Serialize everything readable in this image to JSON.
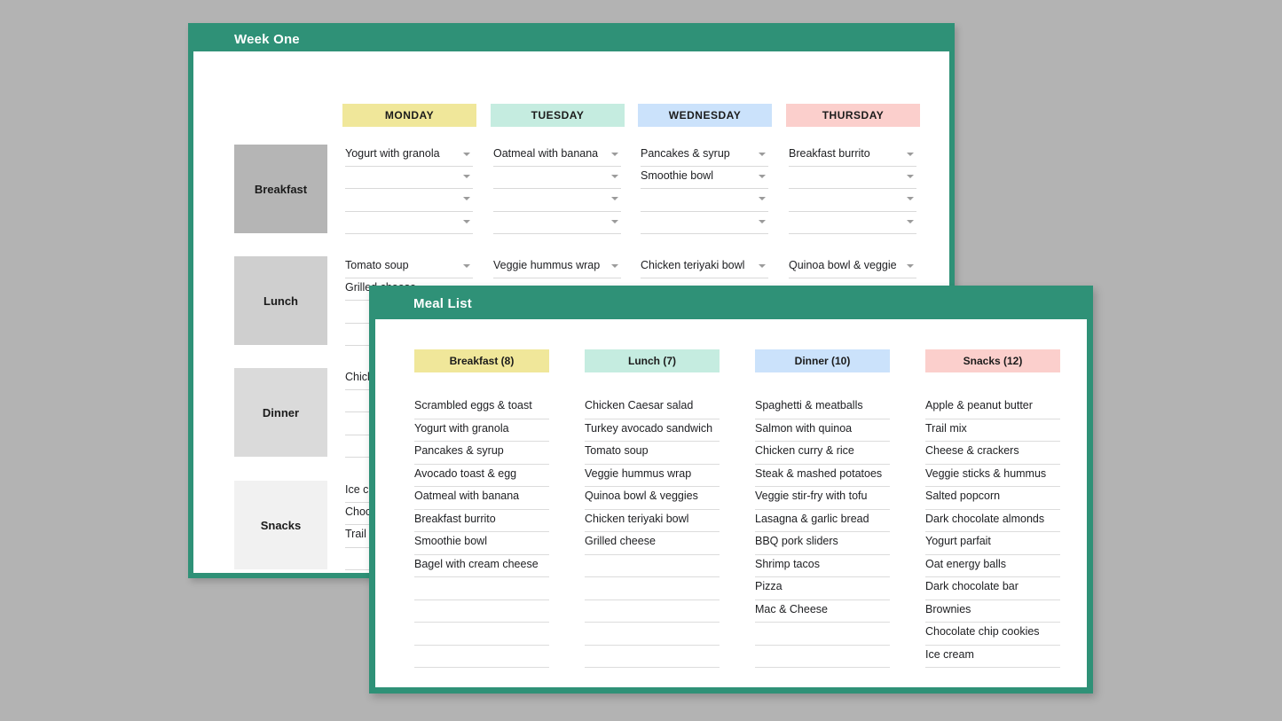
{
  "week_window": {
    "title": "Week One",
    "days": [
      {
        "label": "MONDAY",
        "color": "#f0e79a"
      },
      {
        "label": "TUESDAY",
        "color": "#c5ece0"
      },
      {
        "label": "WEDNESDAY",
        "color": "#cbe2fb"
      },
      {
        "label": "THURSDAY",
        "color": "#fbcfcc"
      }
    ],
    "meal_rows": [
      {
        "label": "Breakfast",
        "swatch": "#b5b5b5",
        "columns": [
          [
            "Yogurt with granola",
            "",
            "",
            ""
          ],
          [
            "Oatmeal with banana",
            "",
            "",
            ""
          ],
          [
            "Pancakes & syrup",
            "Smoothie bowl",
            "",
            ""
          ],
          [
            "Breakfast burrito",
            "",
            "",
            ""
          ]
        ]
      },
      {
        "label": "Lunch",
        "swatch": "#cfcfcf",
        "columns": [
          [
            "Tomato soup",
            "Grilled cheese",
            "",
            ""
          ],
          [
            "Veggie hummus wrap",
            "",
            "",
            ""
          ],
          [
            "Chicken teriyaki bowl",
            "",
            "",
            ""
          ],
          [
            "Quinoa bowl & veggies",
            "",
            "",
            ""
          ]
        ]
      },
      {
        "label": "Dinner",
        "swatch": "#dadada",
        "columns": [
          [
            "Chicken curry & rice",
            "",
            "",
            ""
          ],
          [
            "",
            "",
            "",
            ""
          ],
          [
            "",
            "",
            "",
            ""
          ],
          [
            "",
            "",
            "",
            ""
          ]
        ]
      },
      {
        "label": "Snacks",
        "swatch": "#f1f1f1",
        "columns": [
          [
            "Ice cream",
            "Chocolate chip cookies",
            "Trail mix",
            ""
          ],
          [
            "",
            "",
            "",
            ""
          ],
          [
            "",
            "",
            "",
            ""
          ],
          [
            "",
            "",
            "",
            ""
          ]
        ]
      }
    ]
  },
  "list_window": {
    "title": "Meal List",
    "categories": [
      {
        "header": "Breakfast (8)",
        "color": "#f0e79a",
        "items": [
          "Scrambled eggs & toast",
          "Yogurt with granola",
          "Pancakes & syrup",
          "Avocado toast & egg",
          "Oatmeal with banana",
          "Breakfast burrito",
          "Smoothie bowl",
          "Bagel with cream cheese",
          "",
          "",
          "",
          "",
          ""
        ]
      },
      {
        "header": "Lunch (7)",
        "color": "#c5ece0",
        "items": [
          "Chicken Caesar salad",
          "Turkey avocado sandwich",
          "Tomato soup",
          "Veggie hummus wrap",
          "Quinoa bowl & veggies",
          "Chicken teriyaki bowl",
          "Grilled cheese",
          "",
          "",
          "",
          "",
          "",
          ""
        ]
      },
      {
        "header": "Dinner (10)",
        "color": "#cbe2fb",
        "items": [
          "Spaghetti & meatballs",
          "Salmon with quinoa",
          "Chicken curry & rice",
          "Steak & mashed potatoes",
          "Veggie stir-fry with tofu",
          "Lasagna & garlic bread",
          "BBQ pork sliders",
          "Shrimp tacos",
          "Pizza",
          "Mac & Cheese",
          "",
          "",
          ""
        ]
      },
      {
        "header": "Snacks (12)",
        "color": "#fbcfcc",
        "items": [
          "Apple & peanut butter",
          "Trail mix",
          "Cheese & crackers",
          "Veggie sticks & hummus",
          "Salted popcorn",
          "Dark chocolate almonds",
          "Yogurt parfait",
          "Oat energy balls",
          "Dark chocolate bar",
          "Brownies",
          "Chocolate chip cookies",
          "Ice cream",
          ""
        ]
      }
    ]
  },
  "theme": {
    "accent_green": "#2f9177",
    "canvas": "#b3b3b3"
  }
}
